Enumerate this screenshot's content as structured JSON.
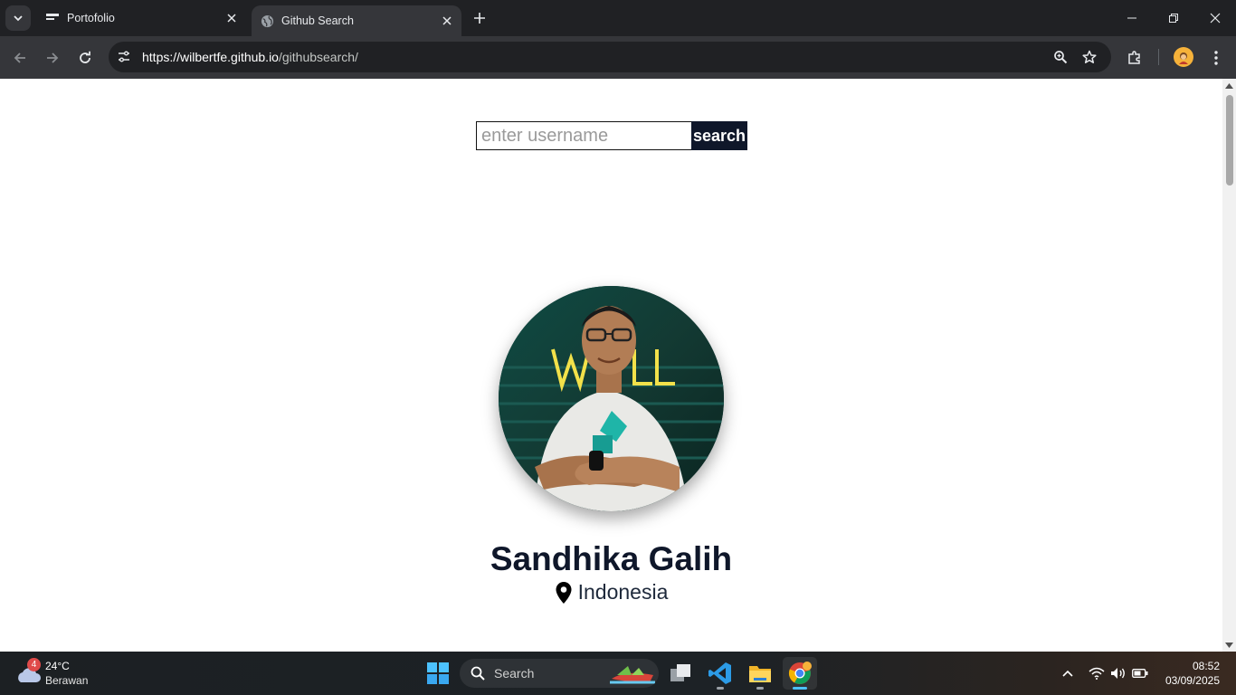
{
  "browser": {
    "tabs": [
      {
        "title": "Portofolio",
        "active": false,
        "favicon": "portfolio-favicon"
      },
      {
        "title": "Github Search",
        "active": true,
        "favicon": "globe-icon"
      }
    ],
    "url": {
      "host": "https://wilbertfe.github.io",
      "path": "/githubsearch/"
    }
  },
  "page": {
    "search": {
      "placeholder": "enter username",
      "button_label": "search"
    },
    "profile": {
      "name": "Sandhika Galih",
      "location": "Indonesia"
    }
  },
  "taskbar": {
    "weather": {
      "badge": "4",
      "temperature": "24°C",
      "condition": "Berawan"
    },
    "search_label": "Search",
    "apps": [
      "task-view",
      "vscode",
      "file-explorer",
      "chrome"
    ],
    "clock": {
      "time": "08:52",
      "date": "03/09/2025"
    }
  },
  "colors": {
    "button_bg": "#0f172a",
    "name_color": "#0f172a",
    "chrome_dark": "#202124",
    "chrome_toolbar": "#35363a"
  }
}
